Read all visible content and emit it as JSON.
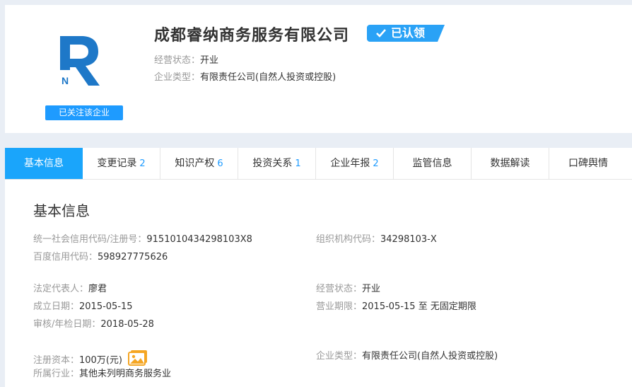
{
  "company": {
    "name": "成都睿纳商务服务有限公司",
    "claimed_badge": "已认领",
    "status_label": "经营状态：",
    "status_value": "开业",
    "type_label": "企业类型：",
    "type_value": "有限责任公司(自然人投资或控股)",
    "follow_button": "已关注该企业"
  },
  "tabs": [
    {
      "label": "基本信息",
      "count": ""
    },
    {
      "label": "变更记录",
      "count": "2"
    },
    {
      "label": "知识产权",
      "count": "6"
    },
    {
      "label": "投资关系",
      "count": "1"
    },
    {
      "label": "企业年报",
      "count": "2"
    },
    {
      "label": "监管信息",
      "count": ""
    },
    {
      "label": "数据解读",
      "count": ""
    },
    {
      "label": "口碑舆情",
      "count": ""
    }
  ],
  "basic": {
    "title": "基本信息",
    "credit_code_label": "统一社会信用代码/注册号：",
    "credit_code_value": "9151010434298103X8",
    "org_code_label": "组织机构代码：",
    "org_code_value": "34298103-X",
    "baidu_code_label": "百度信用代码：",
    "baidu_code_value": "598927775626",
    "legal_rep_label": "法定代表人：",
    "legal_rep_value": "廖君",
    "op_status_label": "经营状态：",
    "op_status_value": "开业",
    "founded_label": "成立日期：",
    "founded_value": "2015-05-15",
    "term_label": "营业期限：",
    "term_value": "2015-05-15 至 无固定期限",
    "audit_label": "审核/年检日期：",
    "audit_value": "2018-05-28",
    "capital_label": "注册资本：",
    "capital_value": "100万(元)",
    "ent_type_label": "企业类型：",
    "ent_type_value": "有限责任公司(自然人投资或控股)",
    "industry_label": "所属行业：",
    "industry_value": "其他未列明商务服务业"
  },
  "colors": {
    "accent": "#1aa5fb",
    "brand_logo": "#1e78c8",
    "badge": "#2aa2f6"
  },
  "icons": {
    "claimed": "check-icon",
    "capital_image": "image-icon"
  }
}
